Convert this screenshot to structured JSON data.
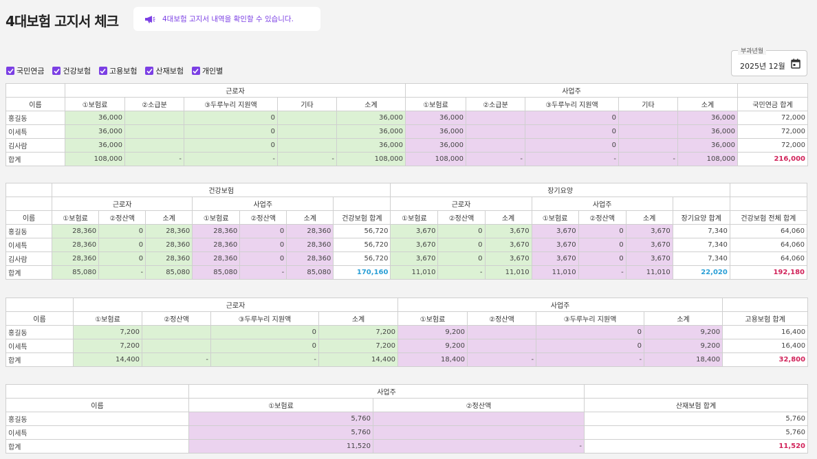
{
  "header": {
    "title": "4대보험 고지서 체크",
    "notice": "4대보험 고지서 내역을 확인할 수 있습니다."
  },
  "filters": [
    "국민연금",
    "건강보험",
    "고용보험",
    "산재보험",
    "개인별"
  ],
  "period": {
    "label": "부과년월",
    "value": "2025년 12월"
  },
  "pension": {
    "group_worker": "근로자",
    "group_employer": "사업주",
    "headers": [
      "이름",
      "①보험료",
      "②소급분",
      "③두루누리 지원액",
      "기타",
      "소계",
      "①보험료",
      "②소급분",
      "③두루누리 지원액",
      "기타",
      "소계",
      "국민연금 합계"
    ],
    "rows": [
      [
        "홍길동",
        "36,000",
        "",
        "0",
        "",
        "36,000",
        "36,000",
        "",
        "0",
        "",
        "36,000",
        "72,000"
      ],
      [
        "이세특",
        "36,000",
        "",
        "0",
        "",
        "36,000",
        "36,000",
        "",
        "0",
        "",
        "36,000",
        "72,000"
      ],
      [
        "김사람",
        "36,000",
        "",
        "0",
        "",
        "36,000",
        "36,000",
        "",
        "0",
        "",
        "36,000",
        "72,000"
      ],
      [
        "합계",
        "108,000",
        "-",
        "-",
        "-",
        "108,000",
        "108,000",
        "-",
        "-",
        "-",
        "108,000",
        "216,000"
      ]
    ]
  },
  "health": {
    "group_health": "건강보험",
    "group_ltc": "장기요양",
    "sub_worker": "근로자",
    "sub_employer": "사업주",
    "headers": [
      "이름",
      "①보험료",
      "②정산액",
      "소계",
      "①보험료",
      "②정산액",
      "소계",
      "건강보험 합계",
      "①보험료",
      "②정산액",
      "소계",
      "①보험료",
      "②정산액",
      "소계",
      "장기요양 합계",
      "건강보험 전체 합계"
    ],
    "rows": [
      [
        "홍길동",
        "28,360",
        "0",
        "28,360",
        "28,360",
        "0",
        "28,360",
        "56,720",
        "3,670",
        "0",
        "3,670",
        "3,670",
        "0",
        "3,670",
        "7,340",
        "64,060"
      ],
      [
        "이세특",
        "28,360",
        "0",
        "28,360",
        "28,360",
        "0",
        "28,360",
        "56,720",
        "3,670",
        "0",
        "3,670",
        "3,670",
        "0",
        "3,670",
        "7,340",
        "64,060"
      ],
      [
        "김사람",
        "28,360",
        "0",
        "28,360",
        "28,360",
        "0",
        "28,360",
        "56,720",
        "3,670",
        "0",
        "3,670",
        "3,670",
        "0",
        "3,670",
        "7,340",
        "64,060"
      ],
      [
        "합계",
        "85,080",
        "-",
        "85,080",
        "85,080",
        "-",
        "85,080",
        "170,160",
        "11,010",
        "-",
        "11,010",
        "11,010",
        "-",
        "11,010",
        "22,020",
        "192,180"
      ]
    ]
  },
  "employment": {
    "group_worker": "근로자",
    "group_employer": "사업주",
    "headers": [
      "이름",
      "①보험료",
      "②정산액",
      "③두루누리 지원액",
      "소계",
      "①보험료",
      "②정산액",
      "③두루누리 지원액",
      "소계",
      "고용보험 합계"
    ],
    "rows": [
      [
        "홍길동",
        "7,200",
        "",
        "0",
        "7,200",
        "9,200",
        "",
        "0",
        "9,200",
        "16,400"
      ],
      [
        "이세특",
        "7,200",
        "",
        "0",
        "7,200",
        "9,200",
        "",
        "0",
        "9,200",
        "16,400"
      ],
      [
        "합계",
        "14,400",
        "-",
        "-",
        "14,400",
        "18,400",
        "-",
        "-",
        "18,400",
        "32,800"
      ]
    ]
  },
  "accident": {
    "group_employer": "사업주",
    "headers": [
      "이름",
      "①보험료",
      "②정산액",
      "산재보험 합계"
    ],
    "rows": [
      [
        "홍길동",
        "5,760",
        "",
        "5,760"
      ],
      [
        "이세특",
        "5,760",
        "",
        "5,760"
      ],
      [
        "합계",
        "11,520",
        "-",
        "11,520"
      ]
    ]
  },
  "colors": {
    "accent": "#7b3fe4",
    "worker_cell": "#dcf1d4",
    "employer_cell": "#ebd3ef",
    "total_pink": "#d1235a",
    "total_blue": "#2a9fd6"
  }
}
